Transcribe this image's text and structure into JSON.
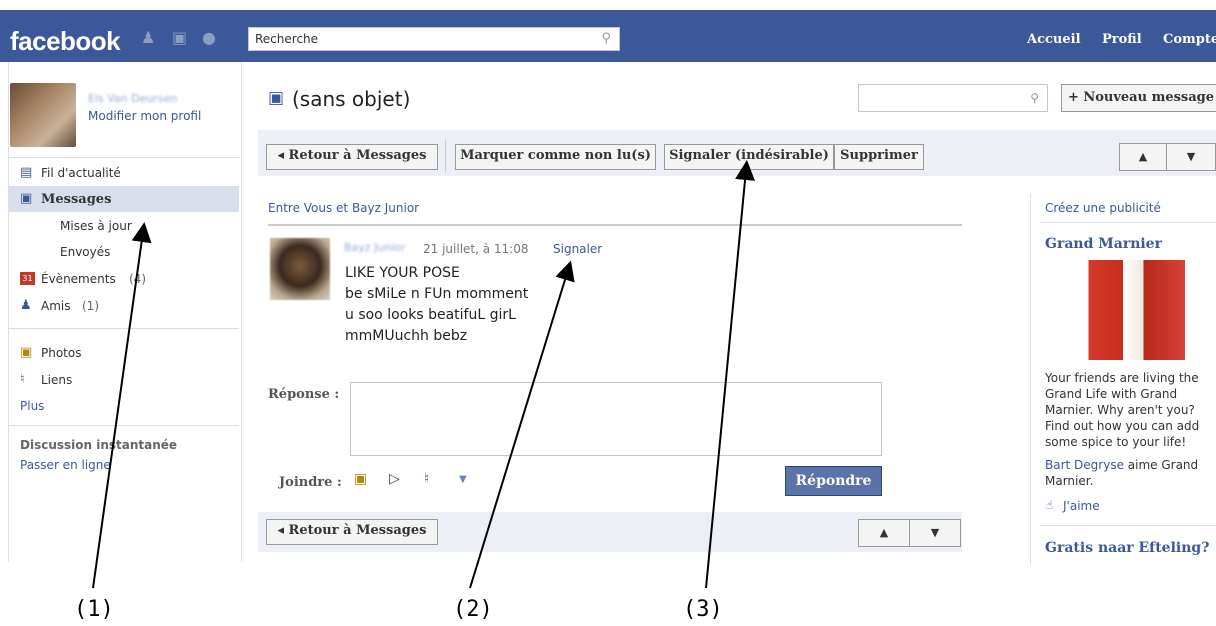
{
  "topbar": {
    "logo": "facebook",
    "search_placeholder": "Recherche",
    "links": [
      "Accueil",
      "Profil",
      "Compte"
    ]
  },
  "sidebar": {
    "profile_name": "Els Van Deursen",
    "edit_profile": "Modifier mon profil",
    "items": [
      {
        "label": "Fil d'actualité"
      },
      {
        "label": "Messages"
      },
      {
        "label": "Mises à jour"
      },
      {
        "label": "Envoyés"
      },
      {
        "label": "Évènements",
        "count": "(4)"
      },
      {
        "label": "Amis",
        "count": "(1)"
      },
      {
        "label": "Photos"
      },
      {
        "label": "Liens"
      },
      {
        "label": "Plus"
      }
    ],
    "chat_title": "Discussion instantanée",
    "chat_link": "Passer en ligne"
  },
  "main": {
    "title": "(sans objet)",
    "new_message": "+ Nouveau message",
    "toolbar": {
      "back": "◂ Retour à Messages",
      "mark_unread": "Marquer comme non lu(s)",
      "report_spam": "Signaler (indésirable)",
      "delete": "Supprimer",
      "up": "▲",
      "down": "▼"
    },
    "between": "Entre Vous et Bayz Junior",
    "message": {
      "sender": "Bayz Junior",
      "date": "21 juillet, à 11:08",
      "report": "Signaler",
      "lines": [
        "LIKE YOUR POSE",
        "be sMiLe n FUn momment",
        "u soo looks beatifuL girL",
        "mmMUuchh bebz"
      ]
    },
    "reply_label": "Réponse :",
    "attach_label": "Joindre :",
    "reply_button": "Répondre",
    "bottom_back": "◂ Retour à Messages"
  },
  "ads": {
    "create": "Créez une publicité",
    "ad1_title": "Grand Marnier",
    "ad1_text": [
      "Your friends are living the",
      "Grand Life with Grand",
      "Marnier. Why aren't you?",
      "Find out how you can add",
      "some spice to your life!"
    ],
    "ad1_social_name": "Bart Degryse",
    "ad1_social_rest": " aime Grand",
    "ad1_social_rest2": "Marnier.",
    "like": "J'aime",
    "ad2_title": "Gratis naar Efteling?"
  },
  "annotations": [
    "(1)",
    "(2)",
    "(3)"
  ]
}
